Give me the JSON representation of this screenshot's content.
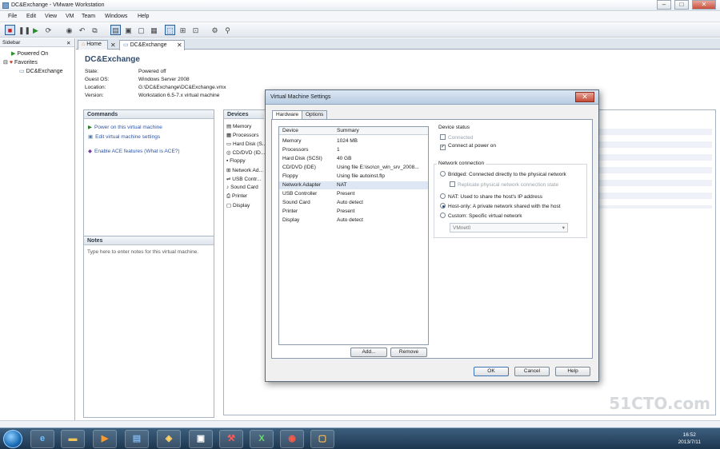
{
  "window": {
    "title": "DC&Exchange - VMware Workstation",
    "min": "–",
    "max": "□",
    "close": "✕"
  },
  "menu": [
    "File",
    "Edit",
    "View",
    "VM",
    "Team",
    "Windows",
    "Help"
  ],
  "sidebar": {
    "title": "Sidebar",
    "close": "✕",
    "items": [
      "Powered On",
      "Favorites",
      "DC&Exchange"
    ]
  },
  "tabs": [
    {
      "label": "Home",
      "close": "✕"
    },
    {
      "label": "DC&Exchange",
      "close": "✕"
    }
  ],
  "vm": {
    "name": "DC&Exchange",
    "details": [
      {
        "key": "State:",
        "value": "Powered off"
      },
      {
        "key": "Guest OS:",
        "value": "Windows Server 2008"
      },
      {
        "key": "Location:",
        "value": "G:\\DC&Exchange\\DC&Exchange.vmx"
      },
      {
        "key": "Version:",
        "value": "Workstation 6.5-7.x virtual machine"
      }
    ]
  },
  "commands": {
    "title": "Commands",
    "items": [
      "Power on this virtual machine",
      "Edit virtual machine settings",
      "Enable ACE features (What is ACE?)"
    ]
  },
  "notes": {
    "title": "Notes",
    "placeholder": "Type here to enter notes for this virtual machine."
  },
  "devices_panel": {
    "title": "Devices",
    "items": [
      "Memory",
      "Processors",
      "Hard Disk (S...",
      "CD/DVD (ID...",
      "Floppy",
      "Network Ad...",
      "USB Contr...",
      "Sound Card",
      "Printer",
      "Display"
    ]
  },
  "dialog": {
    "title": "Virtual Machine Settings",
    "close": "✕",
    "tabs": [
      "Hardware",
      "Options"
    ],
    "device_header": {
      "device": "Device",
      "summary": "Summary"
    },
    "devices": [
      {
        "device": "Memory",
        "summary": "1024 MB"
      },
      {
        "device": "Processors",
        "summary": "1"
      },
      {
        "device": "Hard Disk (SCSI)",
        "summary": "40 GB"
      },
      {
        "device": "CD/DVD (IDE)",
        "summary": "Using file E:\\iso\\cn_win_srv_2008..."
      },
      {
        "device": "Floppy",
        "summary": "Using file autoinst.flp"
      },
      {
        "device": "Network Adapter",
        "summary": "NAT"
      },
      {
        "device": "USB Controller",
        "summary": "Present"
      },
      {
        "device": "Sound Card",
        "summary": "Auto detect"
      },
      {
        "device": "Printer",
        "summary": "Present"
      },
      {
        "device": "Display",
        "summary": "Auto detect"
      }
    ],
    "add_label": "Add...",
    "remove_label": "Remove",
    "device_status": {
      "title": "Device status",
      "connected": "Connected",
      "connect_at_power_on": "Connect at power on"
    },
    "network": {
      "title": "Network connection",
      "bridged": "Bridged: Connected directly to the physical network",
      "replicate": "Replicate physical network connection state",
      "nat": "NAT: Used to share the host's IP address",
      "host_only": "Host-only: A private network shared with the host",
      "custom": "Custom: Specific virtual network",
      "custom_select": "VMnet0"
    },
    "ok_label": "OK",
    "cancel_label": "Cancel",
    "help_label": "Help"
  },
  "taskbar": {
    "time": "16:52",
    "date": "2013/7/11"
  },
  "watermark": "51CTO.com",
  "colors": {
    "accent": "#2d55a8",
    "title": "#314b6a",
    "taskbar": "#1d3650"
  }
}
